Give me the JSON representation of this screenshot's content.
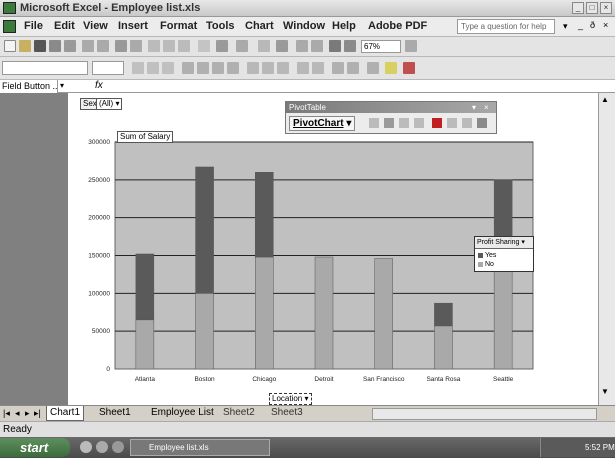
{
  "app": {
    "title": "Microsoft Excel - Employee list.xls"
  },
  "menu": [
    "File",
    "Edit",
    "View",
    "Insert",
    "Format",
    "Tools",
    "Chart",
    "Window",
    "Help",
    "Adobe PDF"
  ],
  "ask_box": {
    "placeholder": "Type a question for help"
  },
  "toolbar": {
    "zoom": "67%"
  },
  "formula_bar": {
    "name_box": "Field Button ...",
    "fx": "fx"
  },
  "page_field": {
    "name": "Sex",
    "value": "(All)"
  },
  "data_field": "Sum of Salary",
  "pivot_toolbar": {
    "title": "PivotTable",
    "chart_button": "PivotChart"
  },
  "legend": {
    "title": "Profit Sharing",
    "items": [
      {
        "label": "Yes",
        "color": "#5a5a5a"
      },
      {
        "label": "No",
        "color": "#a9a9a9"
      }
    ]
  },
  "location_button": "Location",
  "tabs": [
    "Chart1",
    "Sheet1",
    "Employee List",
    "Sheet2",
    "Sheet3"
  ],
  "active_tab": "Chart1",
  "status": "Ready",
  "taskbar": {
    "start": "start",
    "app": "Employee list.xls",
    "clock": "5:52 PM"
  },
  "colors": {
    "plot_bg": "#c0c0c0",
    "series_yes": "#5a5a5a",
    "series_no": "#a9a9a9"
  },
  "chart_data": {
    "type": "bar",
    "stacked": true,
    "categories": [
      "Atlanta",
      "Boston",
      "Chicago",
      "Detroit",
      "San Francisco",
      "Santa Rosa",
      "Seattle"
    ],
    "series": [
      {
        "name": "No",
        "values": [
          65000,
          100000,
          148000,
          148000,
          146000,
          57000,
          150000
        ]
      },
      {
        "name": "Yes",
        "values": [
          87000,
          167000,
          112000,
          0,
          0,
          30000,
          100000
        ]
      }
    ],
    "ylim": [
      0,
      300000
    ],
    "yticks": [
      "0",
      "50000",
      "100000",
      "150000",
      "200000",
      "250000",
      "300000"
    ],
    "grid": true
  }
}
